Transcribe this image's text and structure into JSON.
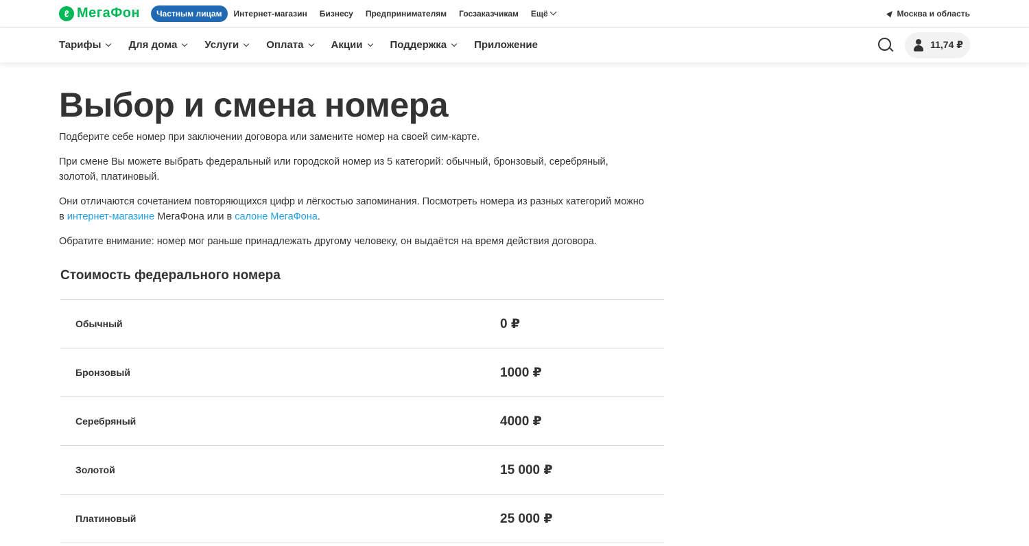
{
  "header": {
    "logo_text": "МегаФон",
    "brand_color": "#00b956",
    "segments": [
      "Частным лицам",
      "Интернет-магазин",
      "Бизнесу",
      "Предпринимателям",
      "Госзаказчикам"
    ],
    "active_segment_color": "#1f6ab3",
    "more_label": "Ещё",
    "region": "Москва и область"
  },
  "nav": {
    "items": [
      {
        "label": "Тарифы",
        "icon": "chevron-down-icon"
      },
      {
        "label": "Для дома",
        "icon": "chevron-down-icon"
      },
      {
        "label": "Услуги",
        "icon": "chevron-down-icon"
      },
      {
        "label": "Оплата",
        "icon": "chevron-down-icon"
      },
      {
        "label": "Акции",
        "icon": "chevron-down-icon"
      },
      {
        "label": "Поддержка",
        "icon": "chevron-down-icon"
      },
      {
        "label": "Приложение"
      }
    ],
    "search_icon": "search-icon",
    "account_icon": "user-icon",
    "balance": "11,74 ₽"
  },
  "main": {
    "title": "Выбор и смена номера",
    "p1": "Подберите себе номер при заключении договора или замените номер на своей сим-карте.",
    "p2": "При смене Вы можете выбрать федеральный или городской номер из 5 категорий: обычный, бронзовый, серебряный, золотой, платиновый.",
    "p3_start": "Они отличаются сочетанием повторяющихся цифр и лёгкостью запоминания. Посмотреть номера из разных категорий можно в ",
    "p3_link1": "интернет-магазине",
    "p3_mid": " МегаФона или в ",
    "p3_link2": "салоне МегаФона",
    "p3_end": ".",
    "p4": "Обратите внимание: номер мог раньше принадлежать другому человеку, он выдаётся на время действия договора.",
    "link_color": "#1f9fe3",
    "section_title": "Стоимость федерального номера",
    "prices": [
      {
        "name": "Обычный",
        "price": "0 ₽"
      },
      {
        "name": "Бронзовый",
        "price": "1000 ₽"
      },
      {
        "name": "Серебряный",
        "price": "4000 ₽"
      },
      {
        "name": "Золотой",
        "price": "15 000 ₽"
      },
      {
        "name": "Платиновый",
        "price": "25 000 ₽"
      }
    ]
  }
}
